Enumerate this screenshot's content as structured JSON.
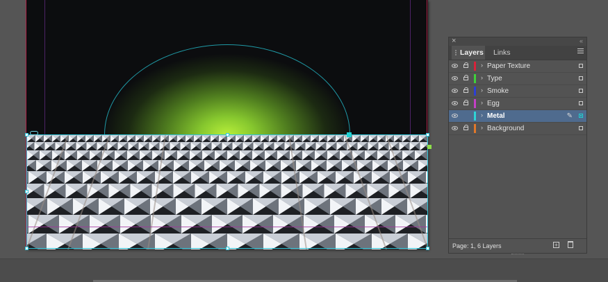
{
  "panel": {
    "tabs": [
      {
        "label": "Layers",
        "active": true
      },
      {
        "label": "Links",
        "active": false
      }
    ],
    "close_glyph": "×",
    "collapse_glyph": "«",
    "layers": [
      {
        "name": "Paper Texture",
        "color": "#d9223a",
        "visible": true,
        "locked": true,
        "selected": false
      },
      {
        "name": "Type",
        "color": "#3fd13a",
        "visible": true,
        "locked": true,
        "selected": false
      },
      {
        "name": "Smoke",
        "color": "#2c3fd6",
        "visible": true,
        "locked": true,
        "selected": false
      },
      {
        "name": "Egg",
        "color": "#c43fc6",
        "visible": true,
        "locked": true,
        "selected": false
      },
      {
        "name": "Metal",
        "color": "#2fd3d6",
        "visible": true,
        "locked": false,
        "selected": true
      },
      {
        "name": "Background",
        "color": "#e0782a",
        "visible": true,
        "locked": true,
        "selected": false
      }
    ],
    "footer": "Page: 1, 6 Layers",
    "new_layer_glyph": "+"
  },
  "canvas": {
    "accent_cyan": "#2ec3d6",
    "glow_green": "#b7ee3a",
    "background": "#0c0d0f"
  }
}
